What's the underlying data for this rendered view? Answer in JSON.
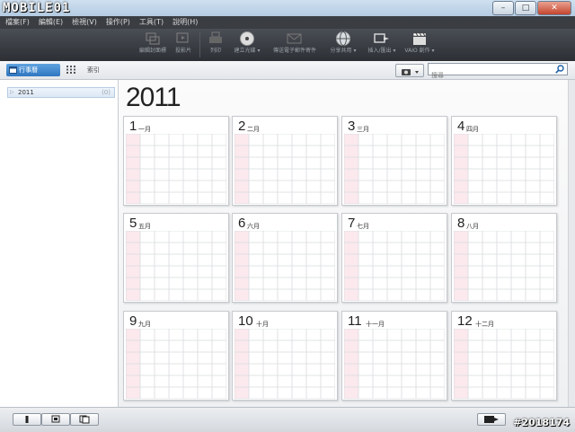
{
  "app": {
    "logo_text": "MOBILE01"
  },
  "window_controls": {
    "minimize": "–",
    "maximize": "□",
    "close": "✕"
  },
  "menu": [
    "檔案(F)",
    "編輯(E)",
    "檢視(V)",
    "操作(P)",
    "工具(T)",
    "說明(H)"
  ],
  "toolbar": [
    {
      "label": "編輯封面標",
      "icon": "edit-cover-icon",
      "active": false
    },
    {
      "label": "投影片",
      "icon": "slideshow-icon",
      "active": false
    },
    {
      "label": "列印",
      "icon": "print-icon",
      "active": false
    },
    {
      "label": "建立光碟 ▾",
      "icon": "disc-icon",
      "active": true
    },
    {
      "label": "傳送電子郵件寄件",
      "icon": "mail-icon",
      "active": false
    },
    {
      "label": "分享共用 ▾",
      "icon": "globe-icon",
      "active": true
    },
    {
      "label": "插入/匯出 ▾",
      "icon": "export-icon",
      "active": true
    },
    {
      "label": "VAIO 創作 ▾",
      "icon": "clapper-icon",
      "active": true
    }
  ],
  "nav": {
    "calendar_tab": "行事曆",
    "index_tab": "索引",
    "search_placeholder": "搜尋"
  },
  "sidebar": {
    "items": [
      {
        "label": "2011",
        "count": "(0)"
      }
    ]
  },
  "year_title": "2011",
  "months": [
    {
      "num": "1",
      "name": "一月"
    },
    {
      "num": "2",
      "name": "二月"
    },
    {
      "num": "3",
      "name": "三月"
    },
    {
      "num": "4",
      "name": "四月"
    },
    {
      "num": "5",
      "name": "五月"
    },
    {
      "num": "6",
      "name": "六月"
    },
    {
      "num": "7",
      "name": "七月"
    },
    {
      "num": "8",
      "name": "八月"
    },
    {
      "num": "9",
      "name": "九月"
    },
    {
      "num": "10",
      "name": "十月"
    },
    {
      "num": "11",
      "name": "十一月"
    },
    {
      "num": "12",
      "name": "十二月"
    }
  ],
  "watermark": "#2018174",
  "colors": {
    "accent": "#2f76c0",
    "sunday_fill": "#fbe9ee",
    "grid_line": "#d9dbde"
  }
}
